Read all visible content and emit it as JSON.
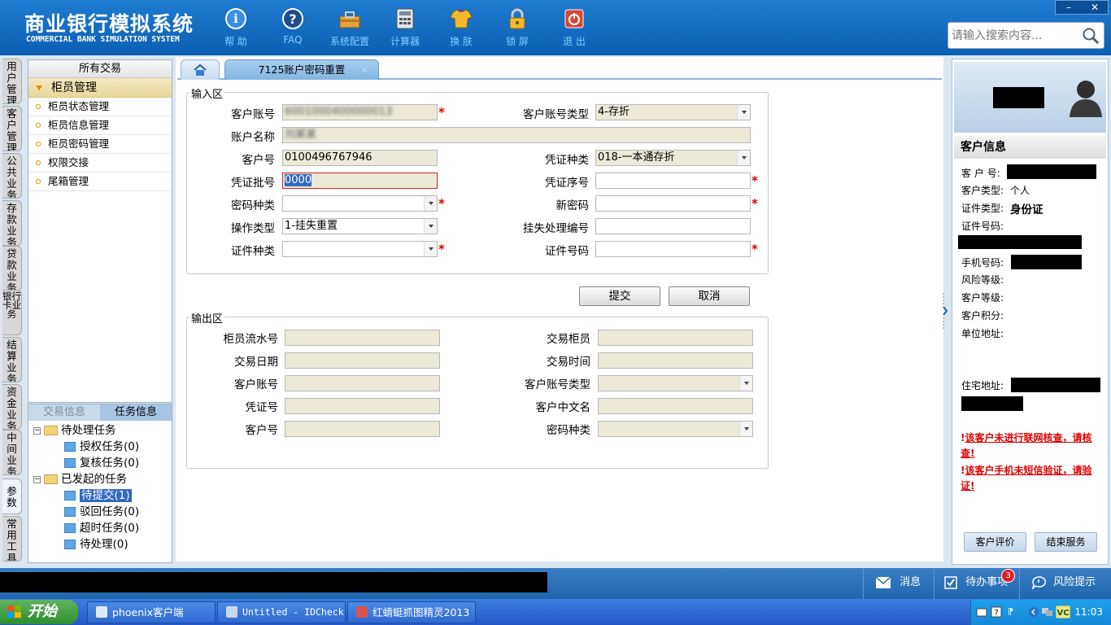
{
  "header": {
    "title": "商业银行模拟系统",
    "subtitle": "COMMERCIAL BANK SIMULATION SYSTEM",
    "tools": [
      {
        "label": "帮 助",
        "icon": "help-icon"
      },
      {
        "label": "FAQ",
        "icon": "faq-icon"
      },
      {
        "label": "系统配置",
        "icon": "toolbox-icon"
      },
      {
        "label": "计算器",
        "icon": "calculator-icon"
      },
      {
        "label": "换 肤",
        "icon": "shirt-icon"
      },
      {
        "label": "锁 屏",
        "icon": "lock-icon"
      },
      {
        "label": "退 出",
        "icon": "power-icon"
      }
    ],
    "window_buttons": {
      "minimize": "–",
      "close": "✕"
    },
    "search_placeholder": "请输入搜索内容..."
  },
  "side_nav": [
    "用户管理",
    "客户管理",
    "公共业务",
    "存款业务",
    "贷款业务",
    "银行卡业务",
    "结算业务",
    "资金业务",
    "中间业务",
    "参数",
    "常用工具"
  ],
  "left_menu": {
    "header": "所有交易",
    "group": "柜员管理",
    "items": [
      "柜员状态管理",
      "柜员信息管理",
      "柜员密码管理",
      "权限交接",
      "尾箱管理"
    ]
  },
  "task_panel": {
    "tabs": [
      "交易信息",
      "任务信息"
    ],
    "tree": {
      "pending": "待处理任务",
      "pending_items": [
        "授权任务(0)",
        "复核任务(0)"
      ],
      "initiated": "已发起的任务",
      "initiated_items": [
        "待提交(1)",
        "驳回任务(0)",
        "超时任务(0)",
        "待处理(0)"
      ]
    }
  },
  "tabs": {
    "active": "7125账户密码重置",
    "close": "×"
  },
  "input_area": {
    "title": "输入区",
    "labels": {
      "cust_account": "客户账号",
      "cust_account_type": "客户账号类型",
      "account_name": "账户名称",
      "cust_no": "客户号",
      "voucher_type": "凭证种类",
      "voucher_batch": "凭证批号",
      "voucher_seq": "凭证序号",
      "pwd_type": "密码种类",
      "new_pwd": "新密码",
      "op_type": "操作类型",
      "loss_no": "挂失处理编号",
      "id_type": "证件种类",
      "id_no": "证件号码"
    },
    "values": {
      "cust_account": "6001000400000013",
      "cust_account_type": "4-存折",
      "account_name": "刘某某",
      "cust_no": "0100496767946",
      "voucher_type": "018-一本通存折",
      "voucher_batch": "0000",
      "op_type": "1-挂失重置"
    }
  },
  "buttons": {
    "submit": "提交",
    "cancel": "取消"
  },
  "output_area": {
    "title": "输出区",
    "labels": {
      "teller_seq": "柜员流水号",
      "tx_teller": "交易柜员",
      "tx_date": "交易日期",
      "tx_time": "交易时间",
      "cust_account": "客户账号",
      "cust_account_type": "客户账号类型",
      "voucher_no": "凭证号",
      "cust_cn_name": "客户中文名",
      "cust_no": "客户号",
      "pwd_type": "密码种类"
    }
  },
  "customer_info": {
    "title": "客户信息",
    "labels": {
      "cust_no": "客 户 号:",
      "cust_type": "客户类型:",
      "id_type": "证件类型:",
      "id_no": "证件号码:",
      "phone": "手机号码:",
      "risk": "风险等级:",
      "level": "客户等级:",
      "points": "客户积分:",
      "work_addr": "单位地址:",
      "home_addr": "住宅地址:"
    },
    "values": {
      "cust_type": "个人",
      "id_type": "身份证"
    },
    "warnings": [
      {
        "mark": "!",
        "text": "该客户未进行联网核查，请核查!"
      },
      {
        "mark": "!",
        "text": "该客户手机未短信验证，请验证!"
      }
    ],
    "buttons": {
      "rate": "客户评价",
      "end": "结束服务"
    }
  },
  "bottom_bar": {
    "messages": "消息",
    "todo": "待办事项",
    "todo_count": "3",
    "risk": "风险提示"
  },
  "taskbar": {
    "start": "开始",
    "tasks": [
      "phoenix客户端",
      "Untitled - IDCheck",
      "红蜻蜓抓图精灵2013"
    ],
    "time": "11:03"
  }
}
